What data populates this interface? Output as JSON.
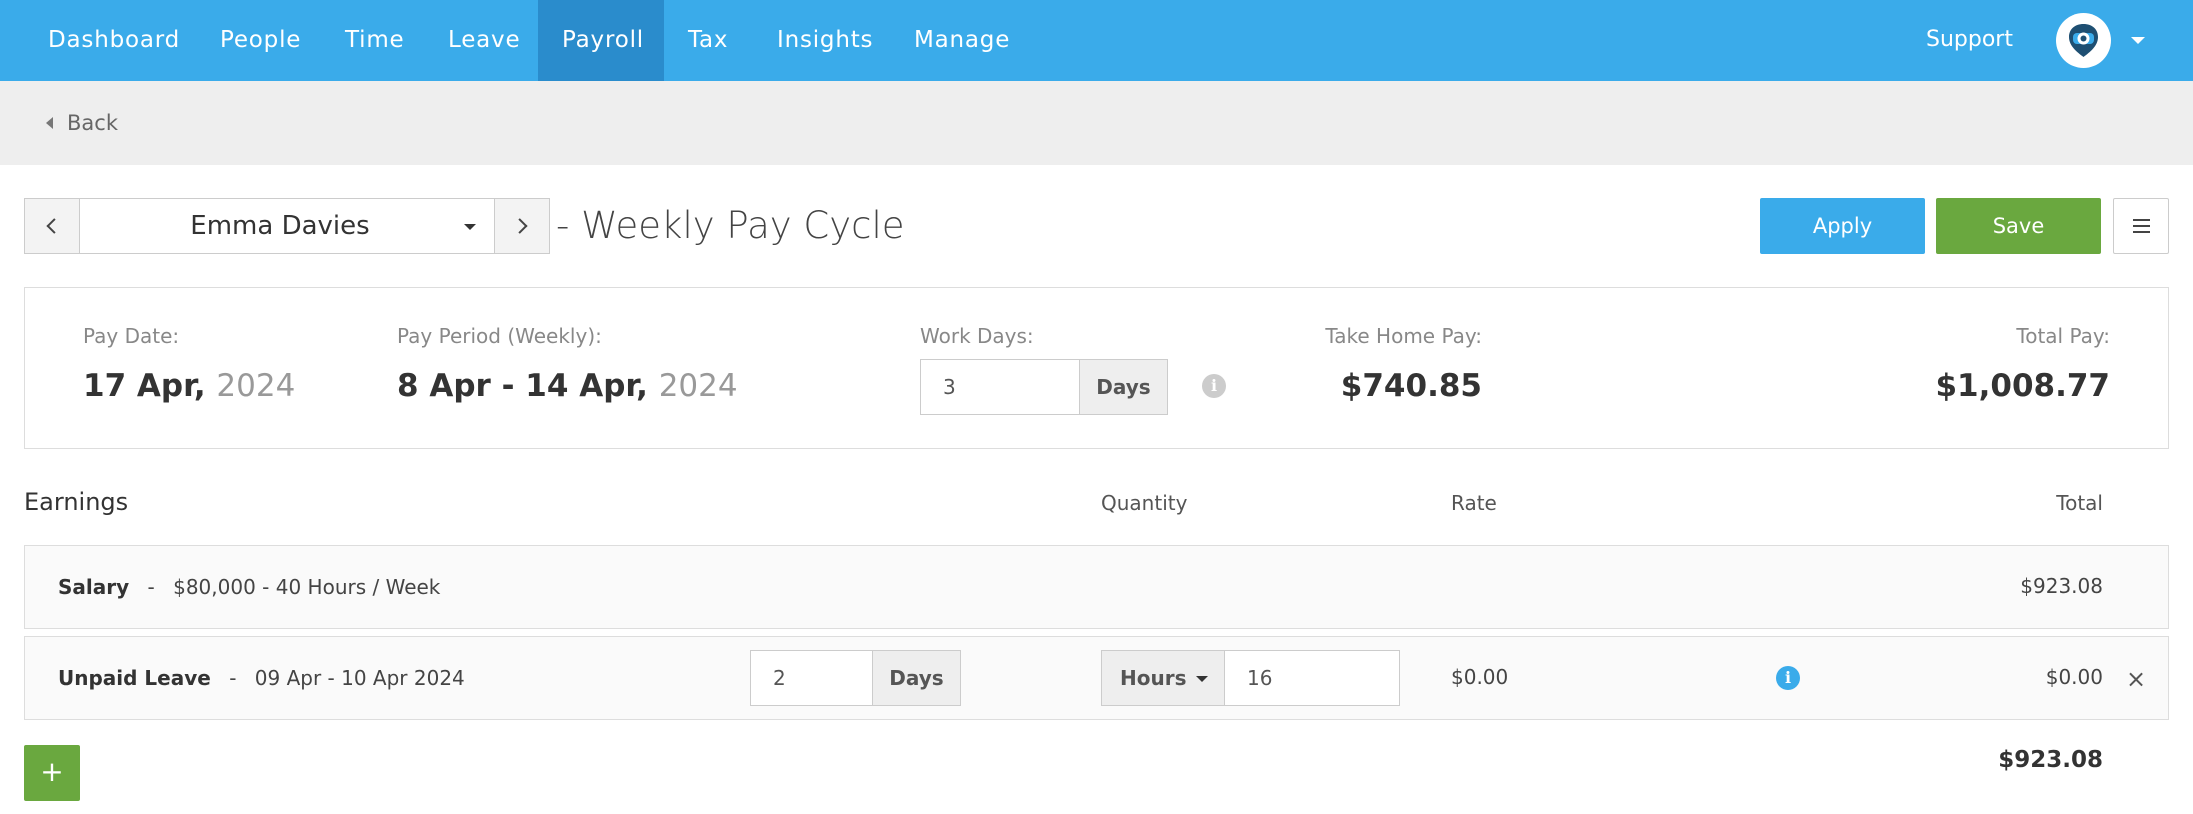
{
  "nav": {
    "items": [
      {
        "label": "Dashboard"
      },
      {
        "label": "People"
      },
      {
        "label": "Time"
      },
      {
        "label": "Leave"
      },
      {
        "label": "Payroll",
        "active": true
      },
      {
        "label": "Tax"
      },
      {
        "label": "Insights"
      },
      {
        "label": "Manage"
      }
    ],
    "support_label": "Support"
  },
  "subbar": {
    "back_label": "Back"
  },
  "pay_run": {
    "employee_name": "Emma Davies",
    "cycle_label": "- Weekly Pay Cycle",
    "apply_label": "Apply",
    "save_label": "Save"
  },
  "summary": {
    "pay_date_label": "Pay Date:",
    "pay_date": "17 Apr,",
    "pay_date_year": "2024",
    "pay_period_label": "Pay Period (Weekly):",
    "pay_period": "8 Apr - 14 Apr,",
    "pay_period_year": "2024",
    "work_days_label": "Work Days:",
    "work_days_value": "3",
    "work_days_unit": "Days",
    "take_home_label": "Take Home Pay:",
    "take_home_value": "$740.85",
    "total_pay_label": "Total Pay:",
    "total_pay_value": "$1,008.77"
  },
  "earnings": {
    "title": "Earnings",
    "columns": {
      "quantity": "Quantity",
      "rate": "Rate",
      "total": "Total"
    },
    "rows": [
      {
        "name": "Salary",
        "separator": "-",
        "detail": "$80,000 - 40 Hours / Week",
        "total": "$923.08"
      },
      {
        "name": "Unpaid Leave",
        "separator": "-",
        "detail": "09 Apr - 10 Apr 2024",
        "days_value": "2",
        "days_unit": "Days",
        "quantity_unit": "Hours",
        "quantity_value": "16",
        "rate": "$0.00",
        "total": "$0.00"
      }
    ],
    "add_label": "+",
    "grand_total": "$923.08"
  },
  "icons": {
    "info": "i",
    "remove": "×"
  },
  "colors": {
    "nav_bg": "#3aabea",
    "nav_active": "#2a8ccc",
    "apply": "#3aabea",
    "save": "#6aa83f",
    "add": "#6aa83f"
  }
}
